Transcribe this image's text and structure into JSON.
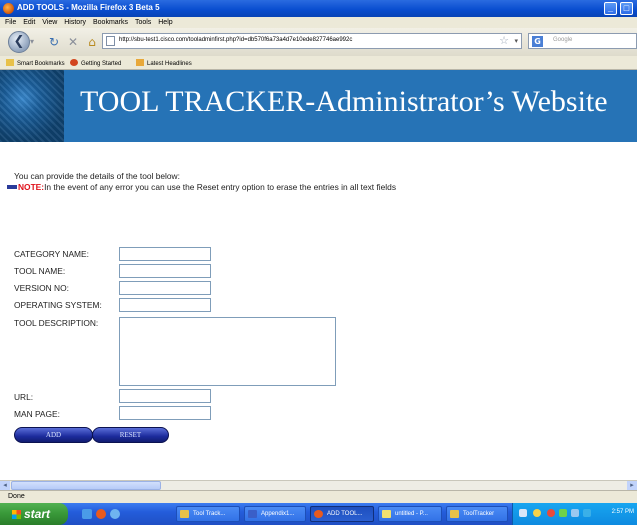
{
  "window": {
    "title": "ADD TOOLS - Mozilla Firefox 3 Beta 5",
    "min_label": "_",
    "max_label": "□"
  },
  "menu": [
    "File",
    "Edit",
    "View",
    "History",
    "Bookmarks",
    "Tools",
    "Help"
  ],
  "nav": {
    "url": "http://sbu-test1.cisco.com/tooladminfirst.php?id=db570f6a73a4d7e10ede827746ae992c",
    "search_placeholder": "Google"
  },
  "bookmarks": [
    "Smart Bookmarks",
    "Getting Started",
    "Latest Headlines"
  ],
  "page": {
    "banner_title": "TOOL TRACKER-Administrator’s Website",
    "intro": "You can provide the details of the tool below:",
    "note_label": "NOTE:",
    "note_text": "In the event of any error you can use the Reset entry option to erase the entries in all text fields",
    "fields": {
      "category": "CATEGORY NAME:",
      "tool_name": "TOOL NAME:",
      "version": "VERSION NO:",
      "os": "OPERATING SYSTEM:",
      "description": "TOOL DESCRIPTION:",
      "url": "URL:",
      "man_page": "MAN PAGE:"
    },
    "add_button": "ADD",
    "reset_button": "RESET"
  },
  "status": "Done",
  "taskbar": {
    "start": "start",
    "tasks": [
      "Tool Track...",
      "Appendix1...",
      "ADD TOOL...",
      "untitled - P...",
      "ToolTracker"
    ],
    "clock": "2:57 PM"
  }
}
